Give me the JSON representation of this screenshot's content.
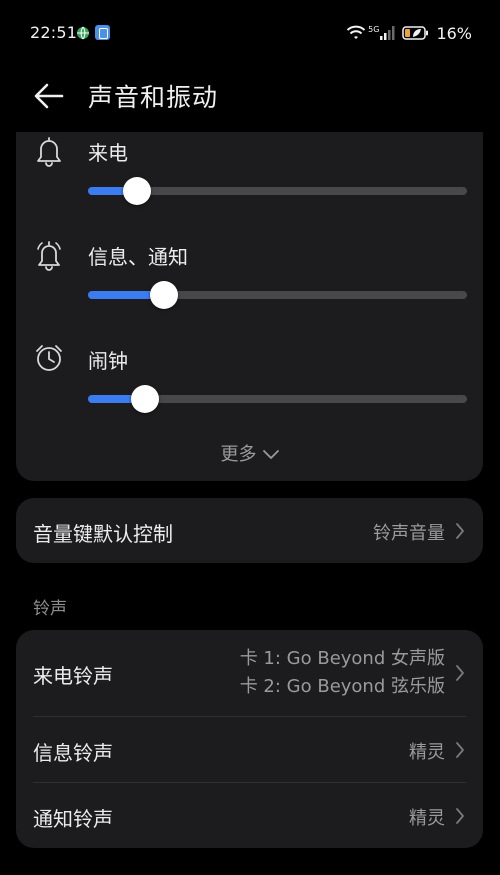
{
  "status_bar": {
    "time": "22:51",
    "network": "5G",
    "battery": "16%"
  },
  "header": {
    "title": "声音和振动"
  },
  "volume": {
    "sliders": [
      {
        "label": "来电",
        "icon": "bell-icon",
        "level": 0.13
      },
      {
        "label": "信息、通知",
        "icon": "bell-ring-icon",
        "level": 0.2
      },
      {
        "label": "闹钟",
        "icon": "alarm-clock-icon",
        "level": 0.15
      }
    ],
    "more_label": "更多"
  },
  "volume_keys": {
    "title": "音量键默认控制",
    "value": "铃声音量"
  },
  "ringtones": {
    "section_label": "铃声",
    "incoming": {
      "title": "来电铃声",
      "sim1": "卡 1: Go Beyond 女声版",
      "sim2": "卡 2: Go Beyond 弦乐版"
    },
    "message": {
      "title": "信息铃声",
      "value": "精灵"
    },
    "notification": {
      "title": "通知铃声",
      "value": "精灵"
    }
  },
  "colors": {
    "accent": "#3b7cf0",
    "card": "#1c1c1e",
    "background": "#000000"
  }
}
